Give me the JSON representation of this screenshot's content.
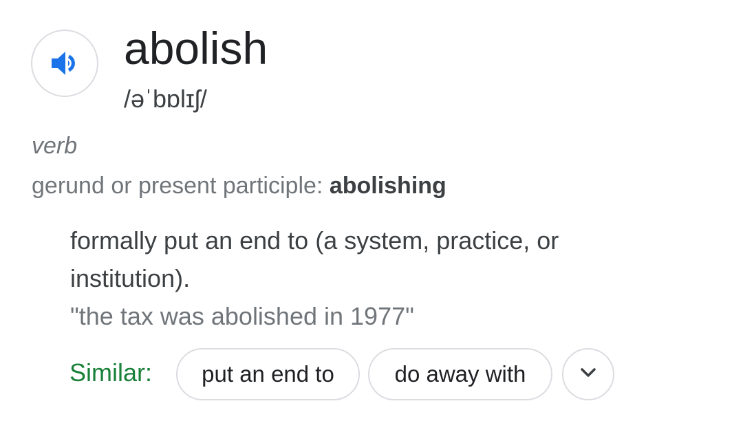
{
  "entry": {
    "word": "abolish",
    "phonetic": "/əˈbɒlɪʃ/",
    "part_of_speech": "verb",
    "inflection": {
      "label": "gerund or present participle:",
      "form": "abolishing"
    },
    "definition": "formally put an end to (a system, practice, or institution).",
    "example": "\"the tax was abolished in 1977\""
  },
  "similar": {
    "label": "Similar:",
    "chips": [
      "put an end to",
      "do away with"
    ]
  },
  "icons": {
    "audio": "speaker-icon",
    "expand": "chevron-down-icon"
  },
  "colors": {
    "accent_blue": "#1a73e8",
    "similar_green": "#188038",
    "border_gray": "#dadce0"
  }
}
